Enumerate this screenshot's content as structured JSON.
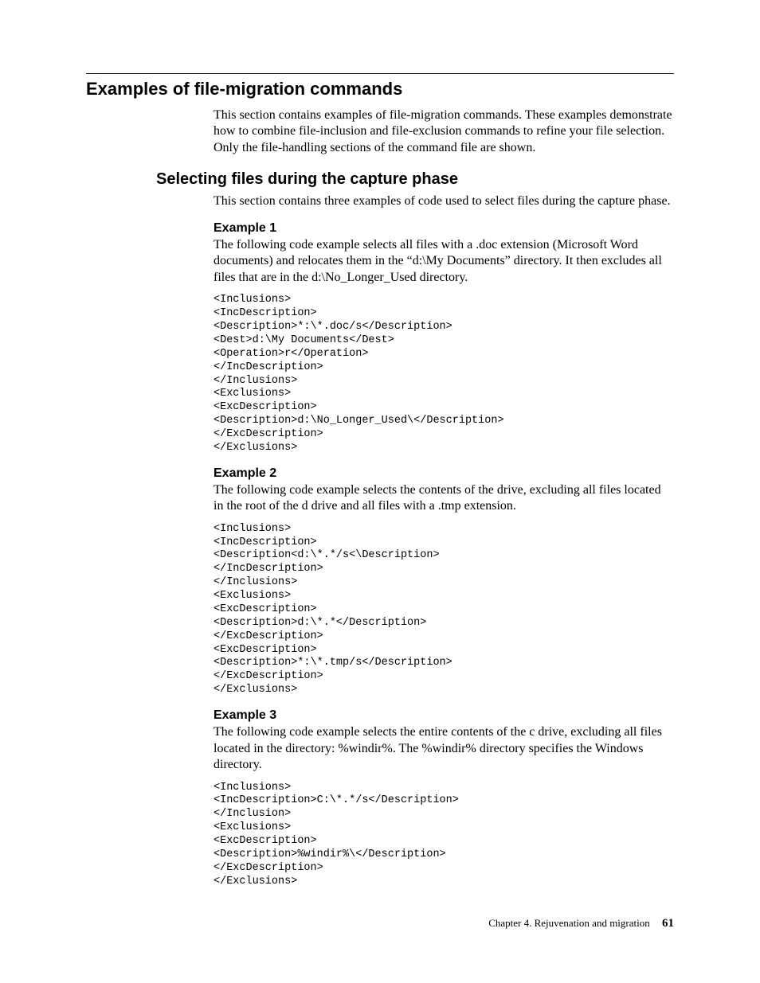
{
  "h1": "Examples of file-migration commands",
  "intro": "This section contains examples of file-migration commands. These examples demonstrate how to combine file-inclusion and file-exclusion commands to refine your file selection. Only the file-handling sections of the command file are shown.",
  "h2": "Selecting files during the capture phase",
  "h2_intro": "This section contains three examples of code used to select files during the capture phase.",
  "ex1_heading": "Example 1",
  "ex1_text": "The following code example selects all files with a .doc extension (Microsoft Word documents) and relocates them in the “d:\\My Documents” directory. It then excludes all files that are in the d:\\No_Longer_Used directory.",
  "ex1_code": "<Inclusions>\n<IncDescription>\n<Description>*:\\*.doc/s</Description>\n<Dest>d:\\My Documents</Dest>\n<Operation>r</Operation>\n</IncDescription>\n</Inclusions>\n<Exclusions>\n<ExcDescription>\n<Description>d:\\No_Longer_Used\\</Description>\n</ExcDescription>\n</Exclusions>",
  "ex2_heading": "Example 2",
  "ex2_text": "The following code example selects the contents of the drive, excluding all files located in the root of the d drive and all files with a .tmp extension.",
  "ex2_code": "<Inclusions>\n<IncDescription>\n<Description<d:\\*.*/s<\\Description>\n</IncDescription>\n</Inclusions>\n<Exclusions>\n<ExcDescription>\n<Description>d:\\*.*</Description>\n</ExcDescription>\n<ExcDescription>\n<Description>*:\\*.tmp/s</Description>\n</ExcDescription>\n</Exclusions>",
  "ex3_heading": "Example 3",
  "ex3_text": "The following code example selects the entire contents of the c drive, excluding all files located in the directory: %windir%. The %windir% directory specifies the Windows directory.",
  "ex3_code": "<Inclusions>\n<IncDescription>C:\\*.*/s</Description>\n</Inclusion>\n<Exclusions>\n<ExcDescription>\n<Description>%windir%\\</Description>\n</ExcDescription>\n</Exclusions>",
  "footer_chapter": "Chapter 4. Rejuvenation and migration",
  "footer_page": "61"
}
